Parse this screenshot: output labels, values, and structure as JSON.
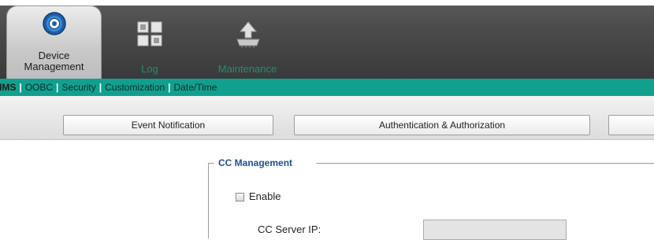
{
  "header": {
    "tabs": [
      {
        "label_line1": "Device",
        "label_line2": "Management",
        "icon": "gear-icon",
        "active": true
      },
      {
        "label": "Log",
        "icon": "grid-log-icon"
      },
      {
        "label": "Maintenance",
        "icon": "upload-chip-icon"
      }
    ]
  },
  "subnav": {
    "items": [
      "IMS",
      "OOBC",
      "Security",
      "Customization",
      "Date/Time"
    ],
    "separator": "|"
  },
  "buttons": {
    "event_notification": "Event Notification",
    "auth": "Authentication & Authorization",
    "third": ""
  },
  "cc_management": {
    "legend": "CC Management",
    "enable_label": "Enable",
    "enable_checked": false,
    "server_ip_label": "CC Server IP:",
    "server_ip_value": ""
  },
  "colors": {
    "accent_teal": "#12a08e",
    "legend_blue": "#1f4f8c",
    "inactive_tab_text": "#1c8f7d"
  }
}
